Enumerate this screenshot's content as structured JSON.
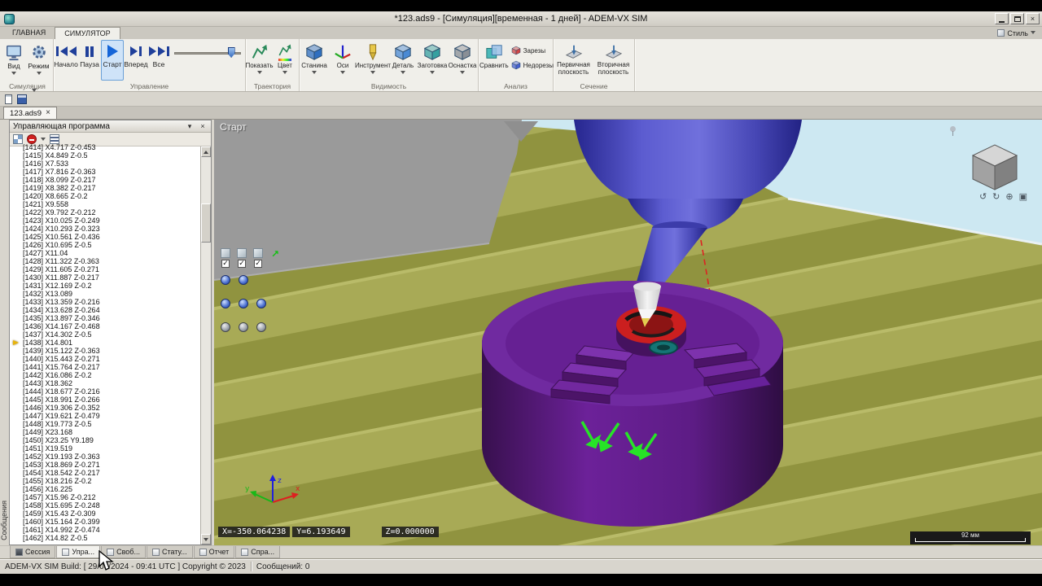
{
  "window": {
    "title": "*123.ads9 - [Симуляция][временная - 1 дней] - ADEM-VX SIM",
    "close_glyph": "×"
  },
  "ribbon": {
    "tabs": [
      {
        "label": "ГЛАВНАЯ"
      },
      {
        "label": "СИМУЛЯТОР"
      }
    ],
    "style_label": "Стиль",
    "groups": [
      {
        "label": "Симуляция",
        "buttons": [
          "Вид",
          "Режим"
        ]
      },
      {
        "label": "Управление",
        "buttons": [
          "Начало",
          "Пауза",
          "Старт",
          "Вперед",
          "Все"
        ]
      },
      {
        "label": "Траектория",
        "buttons": [
          "Показать",
          "Цвет"
        ]
      },
      {
        "label": "Видимость",
        "buttons": [
          "Станина",
          "Оси",
          "Инструмент",
          "Деталь",
          "Заготовка",
          "Оснастка"
        ]
      },
      {
        "label": "Анализ",
        "buttons": [
          "Сравнить",
          "Зарезы",
          "Недорезы"
        ]
      },
      {
        "label": "Сечение",
        "buttons": [
          "Первичная плоскость",
          "Вторичная плоскость"
        ]
      }
    ]
  },
  "document_tab": {
    "label": "123.ads9",
    "close_glyph": "×"
  },
  "left_panel": {
    "title": "Управляющая программа",
    "menu_glyph": "▾",
    "close_glyph": "×",
    "current_line_index": 24,
    "lines": [
      "[1414] X4.717 Z-0.453",
      "[1415] X4.849 Z-0.5",
      "[1416] X7.533",
      "[1417] X7.816 Z-0.363",
      "[1418] X8.099 Z-0.217",
      "[1419] X8.382 Z-0.217",
      "[1420] X8.665 Z-0.2",
      "[1421] X9.558",
      "[1422] X9.792 Z-0.212",
      "[1423] X10.025 Z-0.249",
      "[1424] X10.293 Z-0.323",
      "[1425] X10.561 Z-0.436",
      "[1426] X10.695 Z-0.5",
      "[1427] X11.04",
      "[1428] X11.322 Z-0.363",
      "[1429] X11.605 Z-0.271",
      "[1430] X11.887 Z-0.217",
      "[1431] X12.169 Z-0.2",
      "[1432] X13.089",
      "[1433] X13.359 Z-0.216",
      "[1434] X13.628 Z-0.264",
      "[1435] X13.897 Z-0.346",
      "[1436] X14.167 Z-0.468",
      "[1437] X14.302 Z-0.5",
      "[1438] X14.801",
      "[1439] X15.122 Z-0.363",
      "[1440] X15.443 Z-0.271",
      "[1441] X15.764 Z-0.217",
      "[1442] X16.086 Z-0.2",
      "[1443] X18.362",
      "[1444] X18.677 Z-0.216",
      "[1445] X18.991 Z-0.266",
      "[1446] X19.306 Z-0.352",
      "[1447] X19.621 Z-0.479",
      "[1448] X19.773 Z-0.5",
      "[1449] X23.168",
      "[1450] X23.25 Y9.189",
      "[1451] X19.519",
      "[1452] X19.193 Z-0.363",
      "[1453] X18.869 Z-0.271",
      "[1454] X18.542 Z-0.217",
      "[1455] X18.216 Z-0.2",
      "[1456] X16.225",
      "[1457] X15.96 Z-0.212",
      "[1458] X15.695 Z-0.248",
      "[1459] X15.43 Z-0.309",
      "[1460] X15.164 Z-0.399",
      "[1461] X14.992 Z-0.474",
      "[1462] X14.82 Z-0.5"
    ]
  },
  "sidebar_vertical_label": "Сообщения",
  "viewport": {
    "start_label": "Старт",
    "coord_x": "X=-350.064238",
    "coord_y": "Y=6.193649",
    "coord_z": "Z=0.000000",
    "scale_label": "92 мм",
    "axes": {
      "x": "x",
      "y": "y",
      "z": "z"
    },
    "cube_tools": [
      "↺",
      "↻",
      "⊕",
      "▣"
    ],
    "icons": {
      "check": "✓",
      "arrow": "↗"
    }
  },
  "bottom_tabs": [
    "Сессия",
    "Упра...",
    "Своб...",
    "Стату...",
    "Отчет",
    "Спра..."
  ],
  "status_bar": {
    "build_text": "ADEM-VX SIM Build: [ 29/03/2024 - 09:41 UTC ]  Copyright © 2023",
    "messages": "Сообщений: 0"
  },
  "colors": {
    "accent_blue": "#2f6fc0",
    "part_purple": "#6f239e",
    "floor_olive": "#a8aa56",
    "sky_blue": "#cde8f2",
    "machined_red": "#cb1f1f"
  }
}
